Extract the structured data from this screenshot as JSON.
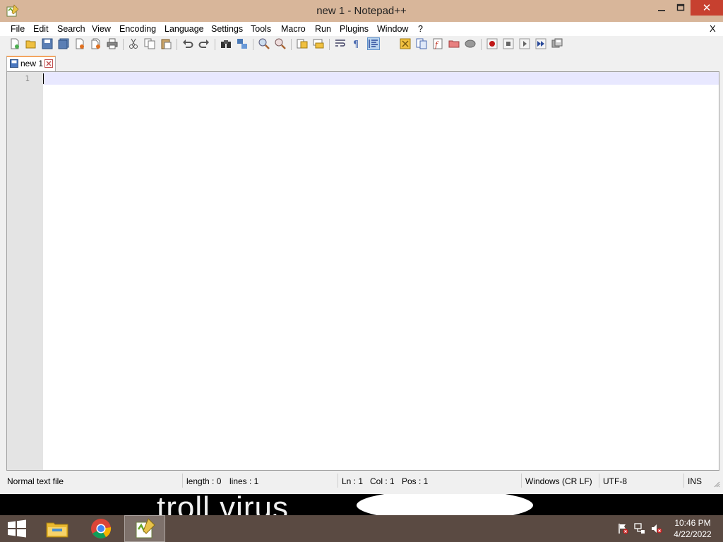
{
  "window": {
    "title": "new 1 - Notepad++",
    "controls": {
      "close_label": "✕"
    }
  },
  "menu": {
    "items": [
      "File",
      "Edit",
      "Search",
      "View",
      "Encoding",
      "Language",
      "Settings",
      "Tools",
      "Macro",
      "Run",
      "Plugins",
      "Window",
      "?"
    ],
    "close_label": "X"
  },
  "toolbar": {
    "icons": [
      "new-file-icon",
      "open-file-icon",
      "save-icon",
      "save-all-icon",
      "close-icon",
      "close-all-icon",
      "print-icon",
      "cut-icon",
      "copy-icon",
      "paste-icon",
      "undo-icon",
      "redo-icon",
      "find-icon",
      "replace-icon",
      "zoom-in-icon",
      "zoom-out-icon",
      "sync-vertical-icon",
      "sync-horizontal-icon",
      "word-wrap-icon",
      "show-all-characters-icon",
      "indent-guide-icon",
      "user-language-icon",
      "document-map-icon",
      "function-list-icon",
      "folder-workspace-icon",
      "monitoring-icon",
      "record-macro-icon",
      "stop-recording-icon",
      "playback-macro-icon",
      "run-macro-multiple-icon",
      "save-macro-icon"
    ],
    "active_icon": "indent-guide-icon"
  },
  "tabs": [
    {
      "label": "new 1"
    }
  ],
  "editor": {
    "line_numbers": [
      "1"
    ],
    "content": ""
  },
  "status": {
    "file_type": "Normal text file",
    "length": "length : 0",
    "lines": "lines : 1",
    "ln": "Ln : 1",
    "col": "Col : 1",
    "pos": "Pos : 1",
    "eol": "Windows (CR LF)",
    "encoding": "UTF-8",
    "mode": "INS"
  },
  "overlay": {
    "text": "troll virus"
  },
  "taskbar": {
    "apps": [
      "file-explorer-icon",
      "chrome-icon",
      "notepad-plus-plus-icon"
    ],
    "tray_icons": [
      "action-center-flag-icon",
      "network-icon",
      "volume-muted-icon"
    ],
    "time": "10:46 PM",
    "date": "4/22/2022"
  },
  "colors": {
    "title_bar": "#d8b69a",
    "close_button": "#c7402f",
    "taskbar": "#5a4a42",
    "tab_accent": "#f4a460",
    "current_line": "#e8e8ff"
  }
}
